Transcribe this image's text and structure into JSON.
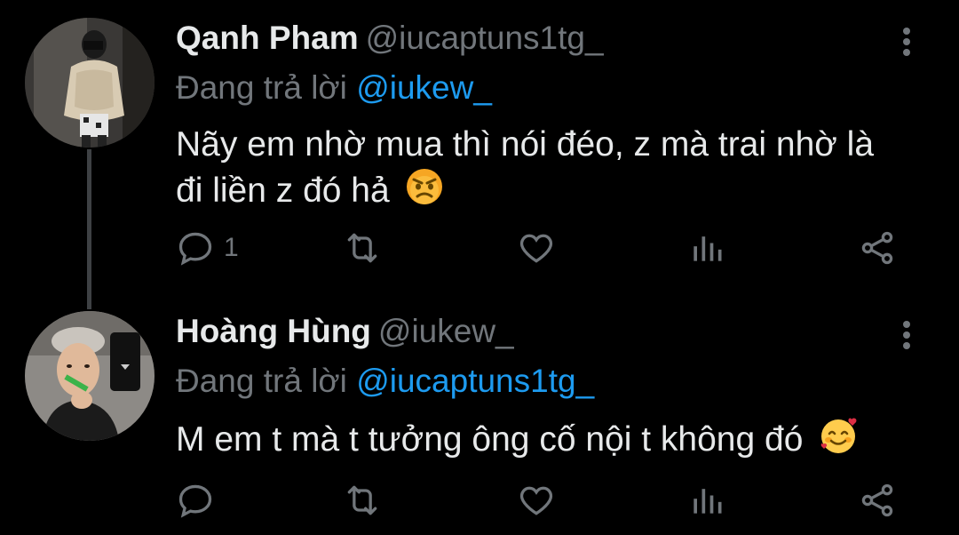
{
  "tweets": [
    {
      "name": "Qanh Pham",
      "handle": "@iucaptuns1tg_",
      "reply_prefix": "Đang trả lời",
      "reply_to": "@iukew_",
      "text": "Nãy em nhờ mua thì nói đéo, z mà trai nhờ là đi liền z đó hả",
      "emoji": "pouting-face",
      "reply_count": "1",
      "avatar": "avatar-mirror-selfie"
    },
    {
      "name": "Hoàng Hùng",
      "handle": "@iukew_",
      "reply_prefix": "Đang trả lời",
      "reply_to": "@iucaptuns1tg_",
      "text": "M em t mà t tưởng ông cố nội t không đó",
      "emoji": "smiling-face-with-hearts",
      "reply_count": "",
      "avatar": "avatar-phone-selfie"
    }
  ],
  "colors": {
    "background": "#000000",
    "text": "#e7e9ea",
    "muted": "#71767b",
    "link": "#1d9bf0"
  }
}
